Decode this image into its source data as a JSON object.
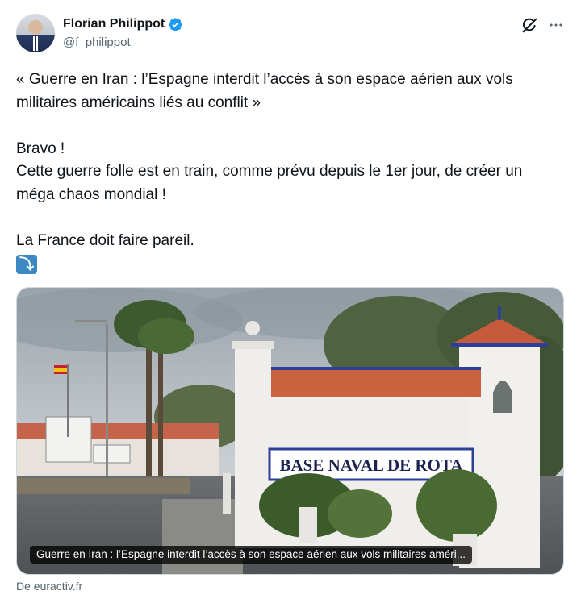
{
  "author": {
    "name": "Florian Philippot",
    "handle": "@f_philippot",
    "verified": true
  },
  "icons": {
    "verified": "verified-badge-icon",
    "grok": "grok-icon",
    "more": "more-options-icon",
    "arrow": "arrow-down-emoji"
  },
  "tweet": {
    "line1": "« Guerre en Iran : l’Espagne interdit l’accès à son espace aérien aux vols militaires américains liés au conflit »",
    "line2": "Bravo !",
    "line3": "Cette guerre folle est en train, comme prévu depuis le 1er jour, de créer un méga chaos mondial !",
    "line4": "La France doit faire pareil.",
    "emoji": "⤵"
  },
  "card": {
    "sign_text": "BASE NAVAL DE ROTA",
    "caption": "Guerre en Iran : l’Espagne interdit l’accès à son espace aérien aux vols militaires améri...",
    "source": "De euractiv.fr"
  },
  "colors": {
    "accent": "#1d9bf0",
    "muted": "#536471",
    "text": "#0f1419"
  }
}
